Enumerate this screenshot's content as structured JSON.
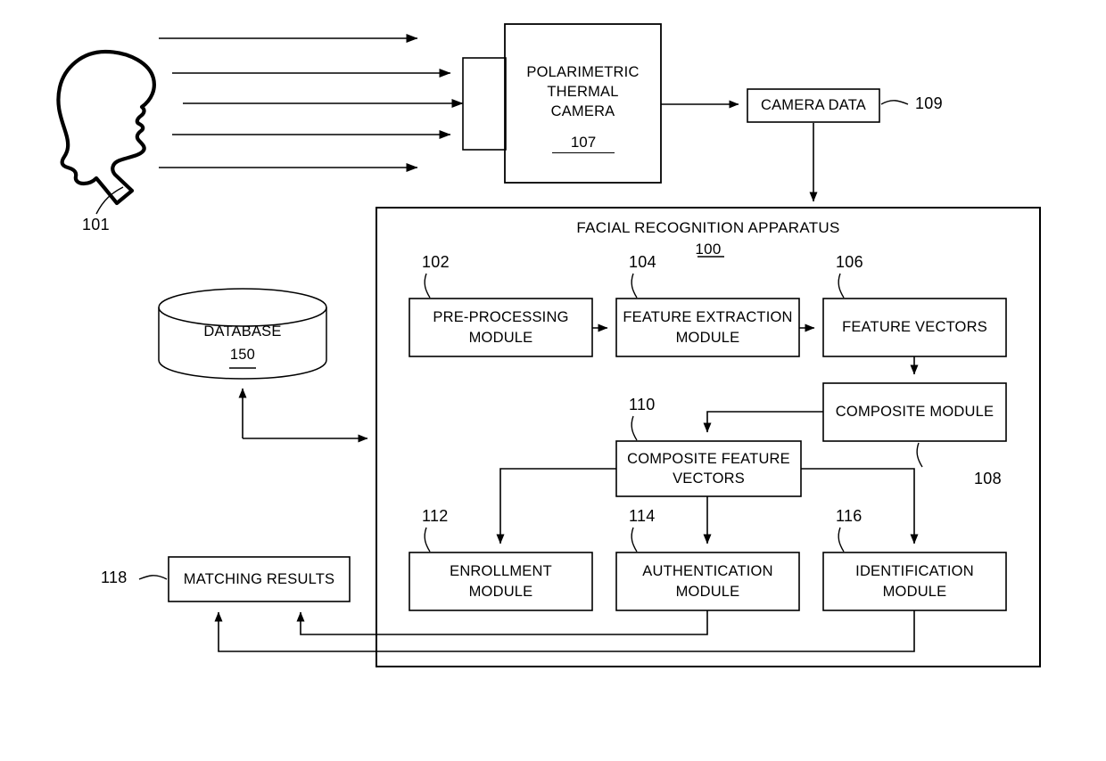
{
  "figure": {
    "apparatus_title": "FACIAL RECOGNITION APPARATUS",
    "apparatus_number": "100"
  },
  "subject": {
    "label": "101",
    "icon": "human-head-profile-silhouette"
  },
  "camera": {
    "line1": "POLARIMETRIC",
    "line2": "THERMAL",
    "line3": "CAMERA",
    "number": "107"
  },
  "camera_data": {
    "label": "CAMERA DATA",
    "ref": "109"
  },
  "database": {
    "label": "DATABASE",
    "number": "150"
  },
  "modules": {
    "preprocessing": {
      "label": "PRE-PROCESSING\nMODULE",
      "ref": "102"
    },
    "feature_extraction": {
      "label": "FEATURE EXTRACTION\nMODULE",
      "ref": "104"
    },
    "feature_vectors": {
      "label": "FEATURE VECTORS",
      "ref": "106"
    },
    "composite_module": {
      "label": "COMPOSITE MODULE",
      "ref": "108"
    },
    "composite_feature_vectors": {
      "label": "COMPOSITE FEATURE\nVECTORS",
      "ref": "110"
    },
    "enrollment": {
      "label": "ENROLLMENT\nMODULE",
      "ref": "112"
    },
    "authentication": {
      "label": "AUTHENTICATION\nMODULE",
      "ref": "114"
    },
    "identification": {
      "label": "IDENTIFICATION\nMODULE",
      "ref": "116"
    },
    "matching_results": {
      "label": "MATCHING RESULTS",
      "ref": "118"
    }
  },
  "colors": {
    "stroke": "#000000",
    "background": "#ffffff"
  }
}
